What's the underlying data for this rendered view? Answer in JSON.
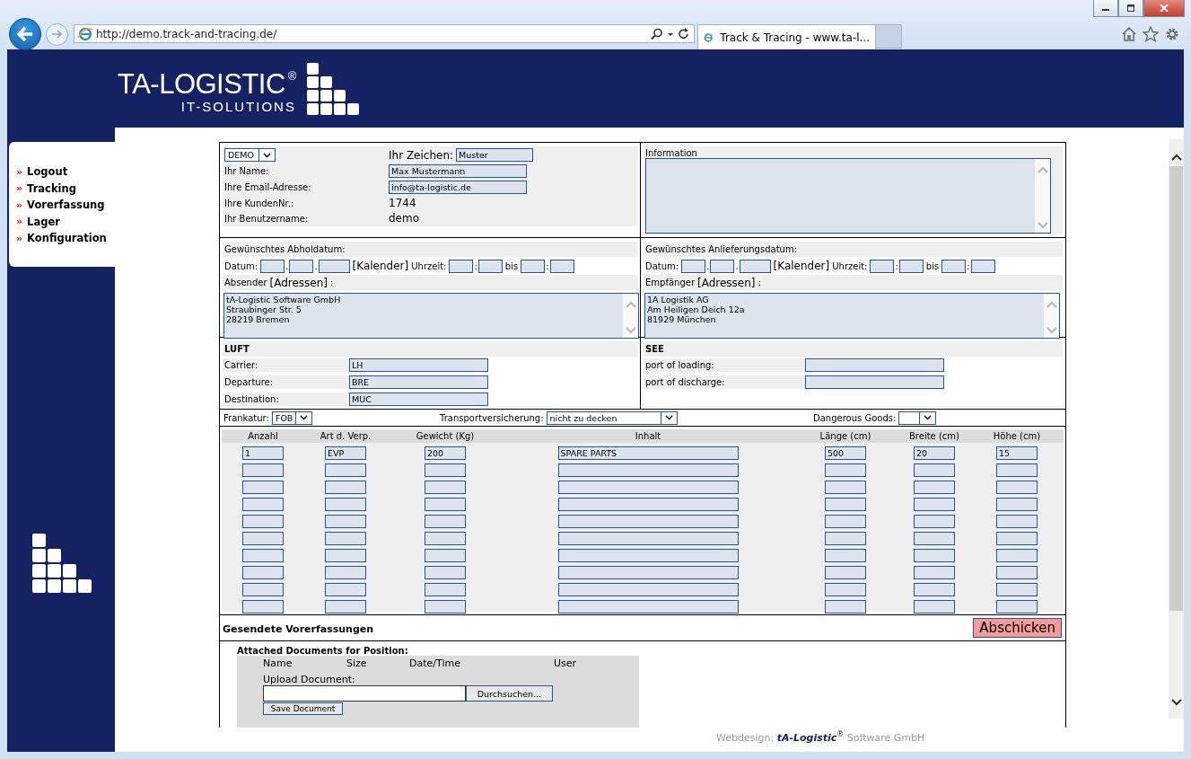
{
  "browser": {
    "url": "http://demo.track-and-tracing.de/",
    "tab_title": "Track & Tracing - www.ta-l..."
  },
  "header": {
    "brand": "TA-LOGISTIC$^{®}$",
    "tagline": "IT-SOLUTIONS"
  },
  "menu": [
    {
      "marker": "»",
      "label": "Logout"
    },
    {
      "marker": "»",
      "label": "Tracking"
    },
    {
      "marker": "»",
      "label": "Vorerfassung"
    },
    {
      "marker": "»",
      "label": "Lager"
    },
    {
      "marker": "»",
      "label": "Konfiguration"
    }
  ],
  "customer": {
    "account_select": "DEMO",
    "reference_label": "Ihr Zeichen:",
    "reference_value": "Muster",
    "rows": [
      {
        "kind": "input",
        "label": "Ihr Name:",
        "value": "Max Mustermann"
      },
      {
        "kind": "input",
        "label": "Ihre Email-Adresse:",
        "value": "info@ta-logistic.de"
      },
      {
        "kind": "text",
        "label": "Ihre KundenNr.:",
        "value": "1744"
      },
      {
        "kind": "text",
        "label": "Ihr Benutzername:",
        "value": "demo"
      }
    ]
  },
  "information": {
    "label": "Information"
  },
  "pickup": {
    "title": "Gewünschtes Abholdatum:",
    "date_row": [
      {
        "kind": "label",
        "text": "Datum:"
      },
      {
        "kind": "day"
      },
      {
        "kind": "sep",
        "text": "."
      },
      {
        "kind": "day"
      },
      {
        "kind": "sep",
        "text": "."
      },
      {
        "kind": "year"
      },
      {
        "kind": "link",
        "text": "[Kalender]"
      },
      {
        "kind": "label",
        "text": "Uhrzeit:"
      },
      {
        "kind": "time"
      },
      {
        "kind": "sep",
        "text": ":"
      },
      {
        "kind": "time"
      },
      {
        "kind": "label",
        "text": "bis"
      },
      {
        "kind": "time"
      },
      {
        "kind": "sep",
        "text": ":"
      },
      {
        "kind": "time"
      }
    ],
    "party_label": "Absender",
    "party_link": "[Adressen]",
    "party_suffix": ":",
    "address": "tA-Logistic Software GmbH\nStraubinger Str. 5\n28219 Bremen"
  },
  "delivery": {
    "title": "Gewünschtes Anlieferungsdatum:",
    "date_row": [
      {
        "kind": "label",
        "text": "Datum:"
      },
      {
        "kind": "day"
      },
      {
        "kind": "sep",
        "text": "."
      },
      {
        "kind": "day"
      },
      {
        "kind": "sep",
        "text": "."
      },
      {
        "kind": "year"
      },
      {
        "kind": "link",
        "text": "[Kalender]"
      },
      {
        "kind": "label",
        "text": "Uhrzeit:"
      },
      {
        "kind": "time"
      },
      {
        "kind": "sep",
        "text": ":"
      },
      {
        "kind": "time"
      },
      {
        "kind": "label",
        "text": "bis"
      },
      {
        "kind": "time"
      },
      {
        "kind": "sep",
        "text": ":"
      },
      {
        "kind": "time"
      }
    ],
    "party_label": "Empfänger",
    "party_link": "[Adressen]",
    "party_suffix": ":",
    "address": "1A Logistik AG\nAm Heiligen Deich 12a\n81929 München"
  },
  "air": {
    "title": "LUFT",
    "rows": [
      {
        "label": "Carrier:",
        "value": "LH"
      },
      {
        "label": "Departure:",
        "value": "BRE"
      },
      {
        "label": "Destination:",
        "value": "MUC"
      }
    ]
  },
  "sea": {
    "title": "SEE",
    "rows": [
      {
        "label": "port of loading:"
      },
      {
        "label": "port of discharge:"
      }
    ]
  },
  "options": [
    {
      "label": "Frankatur:",
      "value": "FOB"
    },
    {
      "label": "Transportversicherung:",
      "value": "nicht zu decken"
    },
    {
      "label": "Dangerous Goods:"
    }
  ],
  "positions": {
    "columns": [
      "Anzahl",
      "Art d. Verp.",
      "Gewicht (Kg)",
      "Inhalt",
      "Länge (cm)",
      "Breite (cm)",
      "Höhe (cm)"
    ],
    "rows": [
      {
        "kind": "filled",
        "values": [
          "1",
          "EVP",
          "200",
          "SPARE PARTS",
          "500",
          "20",
          "15"
        ]
      },
      {
        "kind": "blank"
      },
      {
        "kind": "blank"
      },
      {
        "kind": "blank"
      },
      {
        "kind": "blank"
      },
      {
        "kind": "blank"
      },
      {
        "kind": "blank"
      },
      {
        "kind": "blank"
      },
      {
        "kind": "blank"
      },
      {
        "kind": "blank"
      }
    ]
  },
  "sent": {
    "title": "Gesendete Vorerfassungen",
    "submit": "Abschicken"
  },
  "attachments": {
    "title": "Attached Documents for Position:",
    "columns": [
      "Name",
      "Size",
      "Date/Time",
      "User"
    ],
    "upload_label": "Upload Document:",
    "browse": "Durchsuchen...",
    "save": "Save Document"
  },
  "footer": "Webdesign: *tA-Logistic*$^{®}$ Software GmbH"
}
